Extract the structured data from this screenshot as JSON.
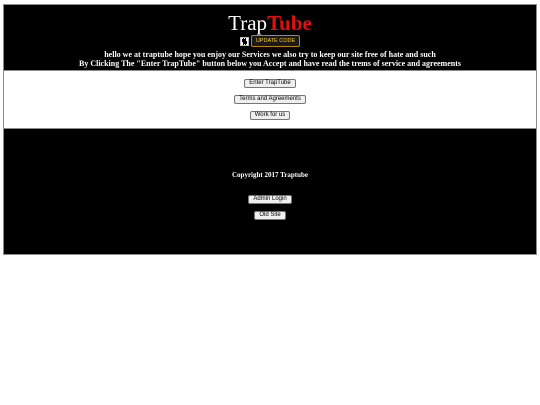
{
  "header": {
    "logo_part1": "Trap",
    "logo_part2": "Tube",
    "update_button": "UPDATE CODE",
    "welcome_line1": "hello we at traptube hope you enjoy our Services we also try to keep our site free of hate and such",
    "welcome_line2": "By Clicking The \"Enter TrapTube\" button below you Accept and have read the trems of service and agreements"
  },
  "main": {
    "enter_button": "Enter TrapTube",
    "terms_button": "Terms and Agreements",
    "work_button": "Work for us"
  },
  "footer": {
    "copyright": "Copyright 2017 Traptube",
    "admin_button": "Admin Login",
    "old_site_button": "Old Site"
  },
  "colors": {
    "background": "#000000",
    "logo_accent": "#e01010",
    "update_button_text": "#ffcc33"
  }
}
